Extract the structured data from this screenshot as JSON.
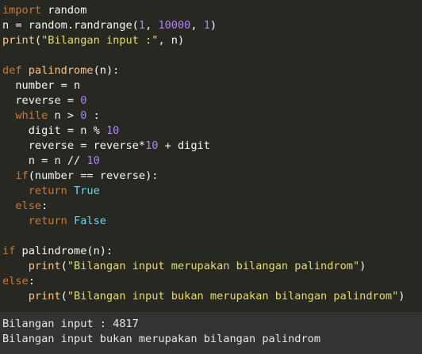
{
  "code": [
    [
      [
        "kw",
        "import"
      ],
      [
        "plain",
        " random"
      ]
    ],
    [
      [
        "plain",
        "n = random.randrange("
      ],
      [
        "num",
        "1"
      ],
      [
        "plain",
        ", "
      ],
      [
        "num",
        "10000"
      ],
      [
        "plain",
        ", "
      ],
      [
        "num",
        "1"
      ],
      [
        "plain",
        ")"
      ]
    ],
    [
      [
        "fn",
        "print"
      ],
      [
        "plain",
        "("
      ],
      [
        "str",
        "\"Bilangan input :\""
      ],
      [
        "plain",
        ", n)"
      ]
    ],
    [],
    [
      [
        "kw",
        "def"
      ],
      [
        "plain",
        " "
      ],
      [
        "fn",
        "palindrome"
      ],
      [
        "plain",
        "(n):"
      ]
    ],
    [
      [
        "plain",
        "  number = n"
      ]
    ],
    [
      [
        "plain",
        "  reverse = "
      ],
      [
        "num",
        "0"
      ]
    ],
    [
      [
        "plain",
        "  "
      ],
      [
        "kw",
        "while"
      ],
      [
        "plain",
        " n > "
      ],
      [
        "num",
        "0"
      ],
      [
        "plain",
        " :"
      ]
    ],
    [
      [
        "plain",
        "    digit = n % "
      ],
      [
        "num",
        "10"
      ]
    ],
    [
      [
        "plain",
        "    reverse = reverse*"
      ],
      [
        "num",
        "10"
      ],
      [
        "plain",
        " + digit"
      ]
    ],
    [
      [
        "plain",
        "    n = n // "
      ],
      [
        "num",
        "10"
      ]
    ],
    [
      [
        "plain",
        "  "
      ],
      [
        "kw",
        "if"
      ],
      [
        "plain",
        "(number == reverse):"
      ]
    ],
    [
      [
        "plain",
        "    "
      ],
      [
        "kw",
        "return"
      ],
      [
        "plain",
        " "
      ],
      [
        "const",
        "True"
      ]
    ],
    [
      [
        "plain",
        "  "
      ],
      [
        "kw",
        "else"
      ],
      [
        "plain",
        ":"
      ]
    ],
    [
      [
        "plain",
        "    "
      ],
      [
        "kw",
        "return"
      ],
      [
        "plain",
        " "
      ],
      [
        "const",
        "False"
      ]
    ],
    [],
    [
      [
        "kw",
        "if"
      ],
      [
        "plain",
        " palindrome(n):"
      ]
    ],
    [
      [
        "plain",
        "    "
      ],
      [
        "fn",
        "print"
      ],
      [
        "plain",
        "("
      ],
      [
        "str",
        "\"Bilangan input merupakan bilangan palindrom\""
      ],
      [
        "plain",
        ")"
      ]
    ],
    [
      [
        "kw",
        "else"
      ],
      [
        "plain",
        ":"
      ]
    ],
    [
      [
        "plain",
        "    "
      ],
      [
        "fn",
        "print"
      ],
      [
        "plain",
        "("
      ],
      [
        "str",
        "\"Bilangan input bukan merupakan bilangan palindrom\""
      ],
      [
        "plain",
        ")"
      ]
    ]
  ],
  "output": {
    "line1": "Bilangan input : 4817",
    "line2": "Bilangan input bukan merupakan bilangan palindrom"
  },
  "colors": {
    "editor_bg": "#272822",
    "output_bg": "#333333",
    "keyword": "#cc7832",
    "function": "#fcc28c",
    "string": "#e6db74",
    "number": "#ae81ff",
    "constant": "#66d9ef",
    "text": "#f8f8f2"
  }
}
